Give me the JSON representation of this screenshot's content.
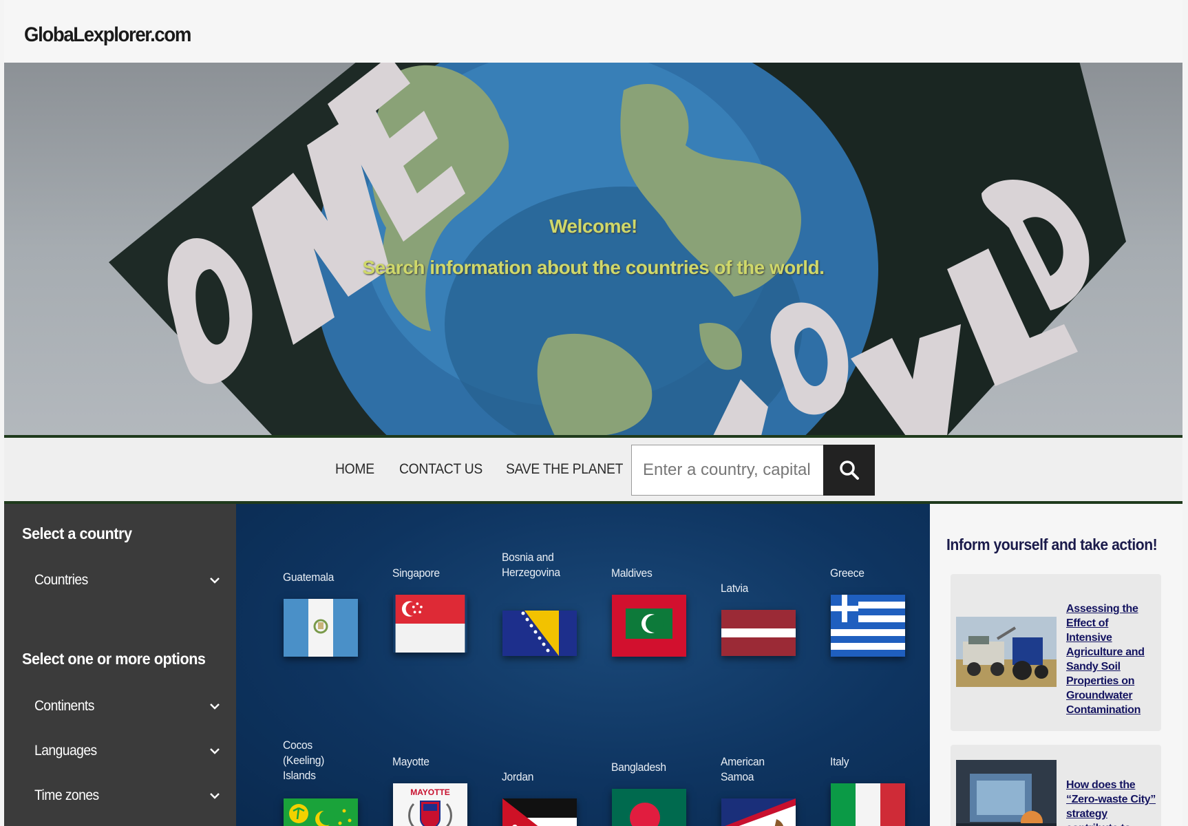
{
  "site": {
    "logo": "GlobaLexplorer.com"
  },
  "hero": {
    "welcome": "Welcome!",
    "subtitle": "Search information about the countries of the world."
  },
  "nav": {
    "home": "HOME",
    "contact": "CONTACT US",
    "save_planet": "SAVE THE PLANET",
    "search_placeholder": "Enter a country, capital or c"
  },
  "sidebar": {
    "select_country_title": "Select a country",
    "countries_label": "Countries",
    "options_title": "Select one or more options",
    "filters": [
      "Continents",
      "Languages",
      "Time zones"
    ]
  },
  "flags": [
    {
      "name": "Guatemala"
    },
    {
      "name": "Singapore"
    },
    {
      "name": "Bosnia and Herzegovina"
    },
    {
      "name": "Maldives"
    },
    {
      "name": "Latvia"
    },
    {
      "name": "Greece"
    },
    {
      "name": "Cocos (Keeling) Islands"
    },
    {
      "name": "Mayotte"
    },
    {
      "name": "Jordan"
    },
    {
      "name": "Bangladesh"
    },
    {
      "name": "American Samoa"
    },
    {
      "name": "Italy"
    }
  ],
  "flag_text": {
    "mayotte": "MAYOTTE"
  },
  "aside": {
    "title": "Inform yourself and take action!",
    "articles": [
      {
        "title": "Assessing the Effect of Intensive Agriculture and Sandy Soil Properties on Groundwater Contamination"
      },
      {
        "title": "How does the “Zero-waste City” strategy contribute to"
      }
    ]
  }
}
